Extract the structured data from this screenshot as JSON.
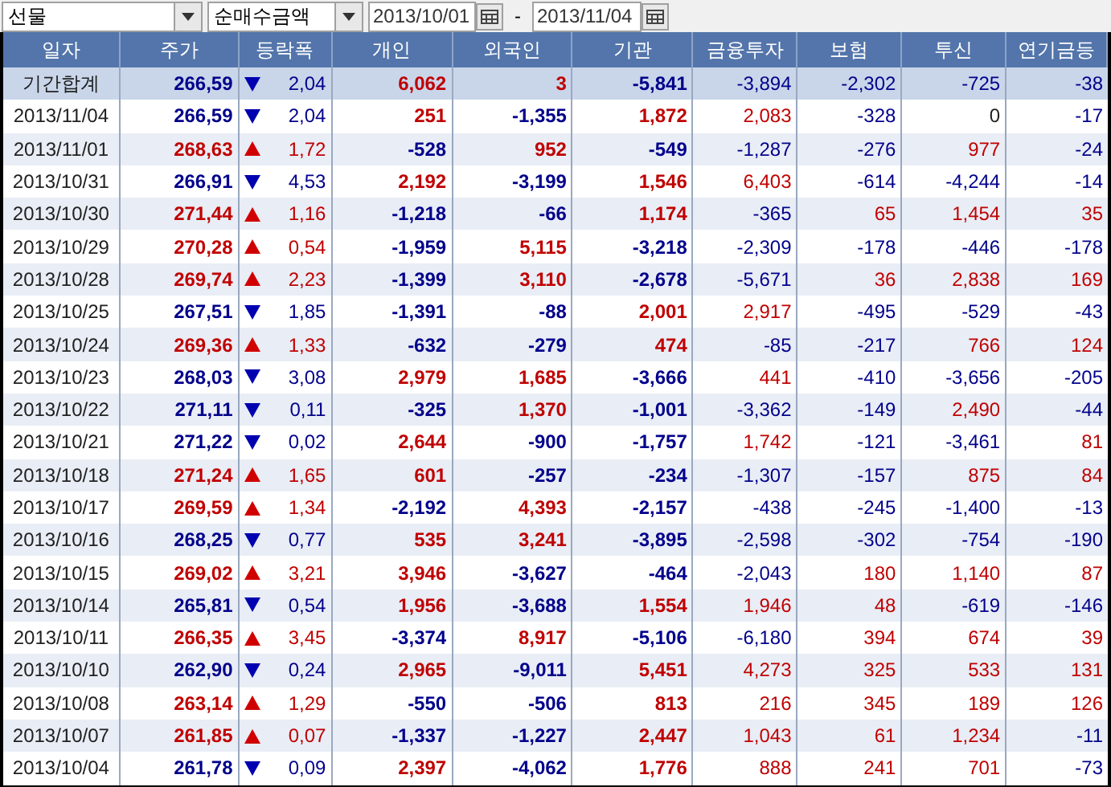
{
  "filters": {
    "market": "선물",
    "metric": "순매수금액",
    "start_date": "2013/10/01",
    "separator": "-",
    "end_date": "2013/11/04"
  },
  "table": {
    "columns": [
      "일자",
      "주가",
      "등락폭",
      "개인",
      "외국인",
      "기관",
      "금융투자",
      "보험",
      "투신",
      "연기금등"
    ],
    "rows": [
      {
        "kind": "summary",
        "date": "기간합계",
        "price": "266,59",
        "rising": false,
        "change": "2,04",
        "values": [
          "6,062",
          "3",
          "-5,841",
          "-3,894",
          "-2,302",
          "-725",
          "-38"
        ]
      },
      {
        "kind": "day",
        "date": "2013/11/04",
        "price": "266,59",
        "rising": false,
        "change": "2,04",
        "values": [
          "251",
          "-1,355",
          "1,872",
          "2,083",
          "-328",
          "0",
          "-17"
        ]
      },
      {
        "kind": "day",
        "date": "2013/11/01",
        "price": "268,63",
        "rising": true,
        "change": "1,72",
        "values": [
          "-528",
          "952",
          "-549",
          "-1,287",
          "-276",
          "977",
          "-24"
        ]
      },
      {
        "kind": "day",
        "date": "2013/10/31",
        "price": "266,91",
        "rising": false,
        "change": "4,53",
        "values": [
          "2,192",
          "-3,199",
          "1,546",
          "6,403",
          "-614",
          "-4,244",
          "-14"
        ]
      },
      {
        "kind": "day",
        "date": "2013/10/30",
        "price": "271,44",
        "rising": true,
        "change": "1,16",
        "values": [
          "-1,218",
          "-66",
          "1,174",
          "-365",
          "65",
          "1,454",
          "35"
        ]
      },
      {
        "kind": "day",
        "date": "2013/10/29",
        "price": "270,28",
        "rising": true,
        "change": "0,54",
        "values": [
          "-1,959",
          "5,115",
          "-3,218",
          "-2,309",
          "-178",
          "-446",
          "-178"
        ]
      },
      {
        "kind": "day",
        "date": "2013/10/28",
        "price": "269,74",
        "rising": true,
        "change": "2,23",
        "values": [
          "-1,399",
          "3,110",
          "-2,678",
          "-5,671",
          "36",
          "2,838",
          "169"
        ]
      },
      {
        "kind": "day",
        "date": "2013/10/25",
        "price": "267,51",
        "rising": false,
        "change": "1,85",
        "values": [
          "-1,391",
          "-88",
          "2,001",
          "2,917",
          "-495",
          "-529",
          "-43"
        ]
      },
      {
        "kind": "day",
        "date": "2013/10/24",
        "price": "269,36",
        "rising": true,
        "change": "1,33",
        "values": [
          "-632",
          "-279",
          "474",
          "-85",
          "-217",
          "766",
          "124"
        ]
      },
      {
        "kind": "day",
        "date": "2013/10/23",
        "price": "268,03",
        "rising": false,
        "change": "3,08",
        "values": [
          "2,979",
          "1,685",
          "-3,666",
          "441",
          "-410",
          "-3,656",
          "-205"
        ]
      },
      {
        "kind": "day",
        "date": "2013/10/22",
        "price": "271,11",
        "rising": false,
        "change": "0,11",
        "values": [
          "-325",
          "1,370",
          "-1,001",
          "-3,362",
          "-149",
          "2,490",
          "-44"
        ]
      },
      {
        "kind": "day",
        "date": "2013/10/21",
        "price": "271,22",
        "rising": false,
        "change": "0,02",
        "values": [
          "2,644",
          "-900",
          "-1,757",
          "1,742",
          "-121",
          "-3,461",
          "81"
        ]
      },
      {
        "kind": "day",
        "date": "2013/10/18",
        "price": "271,24",
        "rising": true,
        "change": "1,65",
        "values": [
          "601",
          "-257",
          "-234",
          "-1,307",
          "-157",
          "875",
          "84"
        ]
      },
      {
        "kind": "day",
        "date": "2013/10/17",
        "price": "269,59",
        "rising": true,
        "change": "1,34",
        "values": [
          "-2,192",
          "4,393",
          "-2,157",
          "-438",
          "-245",
          "-1,400",
          "-13"
        ]
      },
      {
        "kind": "day",
        "date": "2013/10/16",
        "price": "268,25",
        "rising": false,
        "change": "0,77",
        "values": [
          "535",
          "3,241",
          "-3,895",
          "-2,598",
          "-302",
          "-754",
          "-190"
        ]
      },
      {
        "kind": "day",
        "date": "2013/10/15",
        "price": "269,02",
        "rising": true,
        "change": "3,21",
        "values": [
          "3,946",
          "-3,627",
          "-464",
          "-2,043",
          "180",
          "1,140",
          "87"
        ]
      },
      {
        "kind": "day",
        "date": "2013/10/14",
        "price": "265,81",
        "rising": false,
        "change": "0,54",
        "values": [
          "1,956",
          "-3,688",
          "1,554",
          "1,946",
          "48",
          "-619",
          "-146"
        ]
      },
      {
        "kind": "day",
        "date": "2013/10/11",
        "price": "266,35",
        "rising": true,
        "change": "3,45",
        "values": [
          "-3,374",
          "8,917",
          "-5,106",
          "-6,180",
          "394",
          "674",
          "39"
        ]
      },
      {
        "kind": "day",
        "date": "2013/10/10",
        "price": "262,90",
        "rising": false,
        "change": "0,24",
        "values": [
          "2,965",
          "-9,011",
          "5,451",
          "4,273",
          "325",
          "533",
          "131"
        ]
      },
      {
        "kind": "day",
        "date": "2013/10/08",
        "price": "263,14",
        "rising": true,
        "change": "1,29",
        "values": [
          "-550",
          "-506",
          "813",
          "216",
          "345",
          "189",
          "126"
        ]
      },
      {
        "kind": "day",
        "date": "2013/10/07",
        "price": "261,85",
        "rising": true,
        "change": "0,07",
        "values": [
          "-1,337",
          "-1,227",
          "2,447",
          "1,043",
          "61",
          "1,234",
          "-11"
        ]
      },
      {
        "kind": "day",
        "date": "2013/10/04",
        "price": "261,78",
        "rising": false,
        "change": "0,09",
        "values": [
          "2,397",
          "-4,062",
          "1,776",
          "888",
          "241",
          "701",
          "-73"
        ]
      }
    ]
  }
}
